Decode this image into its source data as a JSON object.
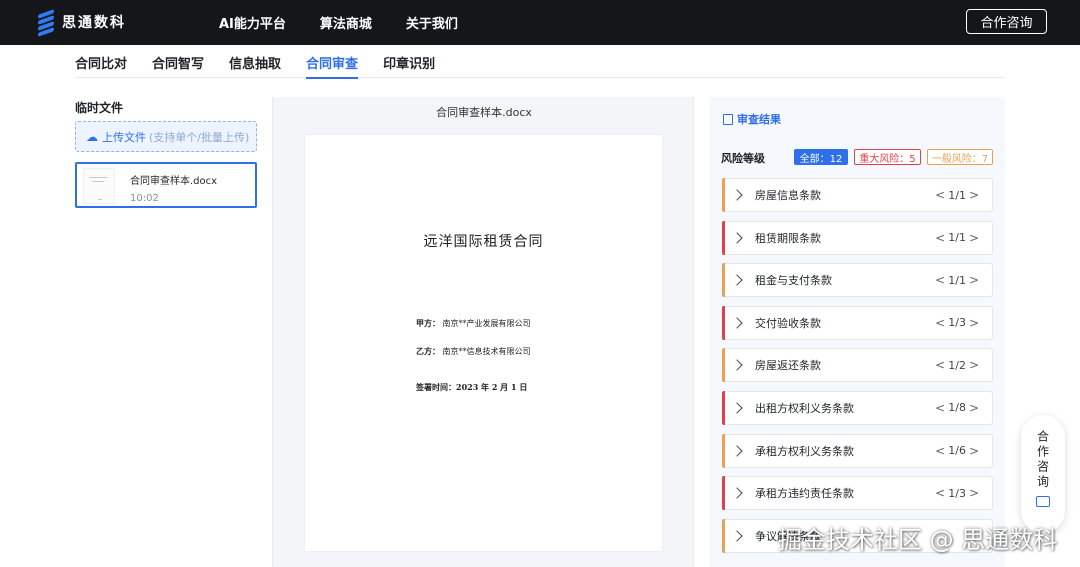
{
  "header": {
    "logo_text": "思通数科",
    "nav": [
      "AI能力平台",
      "算法商城",
      "关于我们"
    ],
    "consult_button": "合作咨询"
  },
  "tabs": [
    {
      "label": "合同比对",
      "active": false
    },
    {
      "label": "合同智写",
      "active": false
    },
    {
      "label": "信息抽取",
      "active": false
    },
    {
      "label": "合同审查",
      "active": true
    },
    {
      "label": "印章识别",
      "active": false
    }
  ],
  "sidebar": {
    "title": "临时文件",
    "upload_label": "上传文件",
    "upload_hint": "(支持单个/批量上传)",
    "file": {
      "name": "合同审查样本.docx",
      "time": "10:02"
    }
  },
  "preview": {
    "file_title": "合同审查样本.docx",
    "doc_title": "远洋国际租赁合同",
    "party_a_label": "甲方：",
    "party_a": "南京**产业发展有限公司",
    "party_b_label": "乙方：",
    "party_b": "南京**信息技术有限公司",
    "sign_label": "签署时间：",
    "sign_date": "2023 年 2 月 1 日"
  },
  "result": {
    "title": "审查结果",
    "risk_label": "风险等级",
    "badges": {
      "all": "全部：12",
      "major": "重大风险：5",
      "normal": "一般风险：7"
    },
    "clauses": [
      {
        "name": "房屋信息条款",
        "page": "1/1",
        "level": "orange"
      },
      {
        "name": "租赁期限条款",
        "page": "1/1",
        "level": "red"
      },
      {
        "name": "租金与支付条款",
        "page": "1/1",
        "level": "orange"
      },
      {
        "name": "交付验收条款",
        "page": "1/3",
        "level": "red"
      },
      {
        "name": "房屋返还条款",
        "page": "1/2",
        "level": "orange"
      },
      {
        "name": "出租方权利义务条款",
        "page": "1/8",
        "level": "red"
      },
      {
        "name": "承租方权利义务条款",
        "page": "1/6",
        "level": "orange"
      },
      {
        "name": "承租方违约责任条款",
        "page": "1/3",
        "level": "red"
      },
      {
        "name": "争议解决条款",
        "page": "",
        "level": "orange"
      }
    ]
  },
  "float_consult": "合作咨询",
  "watermark": "掘金技术社区 @ 思通数科",
  "colors": {
    "accent": "#2f6fec",
    "major_risk": "#e5404a",
    "normal_risk": "#eca052",
    "topbar": "#14161a"
  }
}
